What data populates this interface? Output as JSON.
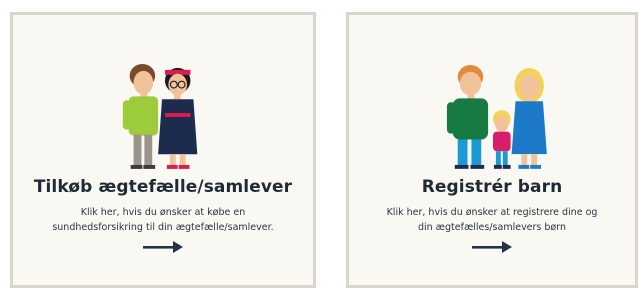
{
  "cards": [
    {
      "title": "Tilkøb ægtefælle/samlever",
      "description": "Klik her, hvis du ønsker at købe en sundhedsforsikring til din ægtefælle/samlever.",
      "arrow_icon": "right-arrow-icon",
      "illustration": "couple-illustration"
    },
    {
      "title": "Registrér barn",
      "description": "Klik her, hvis du ønsker at registrere dine og din ægtefælles/samlevers børn",
      "arrow_icon": "right-arrow-icon",
      "illustration": "family-illustration"
    }
  ],
  "colors": {
    "card_background": "#faf8f2",
    "card_border": "#d8d5cd",
    "text": "#1f2a36",
    "arrow": "#233447"
  }
}
